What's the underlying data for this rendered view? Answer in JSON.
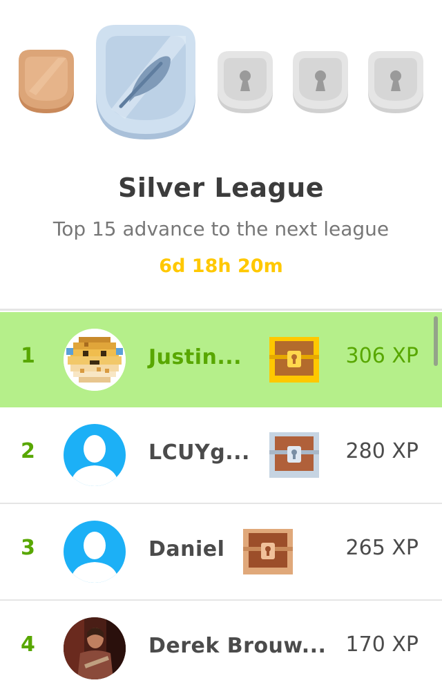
{
  "league": {
    "title": "Silver League",
    "subtitle": "Top 15 advance to the next league",
    "timer": "6d 18h 20m"
  },
  "badges": [
    {
      "name": "bronze",
      "state": "completed"
    },
    {
      "name": "silver",
      "state": "current"
    },
    {
      "name": "locked-1",
      "state": "locked"
    },
    {
      "name": "locked-2",
      "state": "locked"
    },
    {
      "name": "locked-3",
      "state": "locked"
    }
  ],
  "leaderboard": [
    {
      "rank": "1",
      "name": "Justin...",
      "xp": "306 XP",
      "chest": "gold",
      "avatar": "pixel-pufferfish"
    },
    {
      "rank": "2",
      "name": "LCUYg...",
      "xp": "280 XP",
      "chest": "silver",
      "avatar": "default-silhouette"
    },
    {
      "rank": "3",
      "name": "Daniel",
      "xp": "265 XP",
      "chest": "bronze",
      "avatar": "default-silhouette"
    },
    {
      "rank": "4",
      "name": "Derek Brouw...",
      "xp": "170 XP",
      "chest": "none",
      "avatar": "photo"
    }
  ],
  "colors": {
    "promotion_green": "#58a700",
    "highlight_row": "#b5ef8a",
    "timer_gold": "#ffc800",
    "avatar_blue": "#1cb0f6"
  }
}
